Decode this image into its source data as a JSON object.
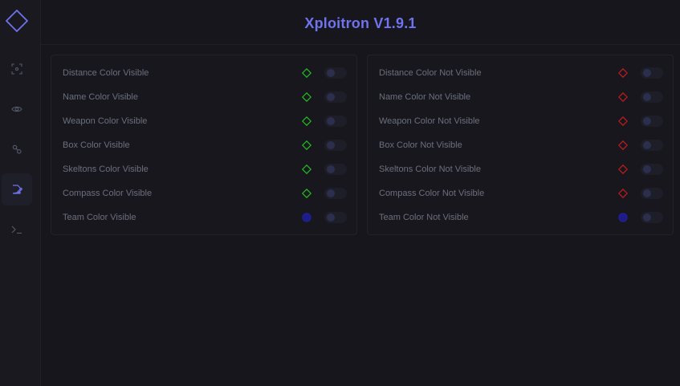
{
  "app": {
    "title": "Xploitron V1.9.1",
    "accent": "#6f73ee"
  },
  "sidebar": {
    "items": [
      {
        "icon": "aim-icon",
        "active": false
      },
      {
        "icon": "eye-icon",
        "active": false
      },
      {
        "icon": "settings-icon",
        "active": false
      },
      {
        "icon": "palette-icon",
        "active": true
      },
      {
        "icon": "terminal-icon",
        "active": false
      }
    ]
  },
  "visible": {
    "rows": [
      {
        "label": "Distance Color Visible",
        "color": "#22c222",
        "shape": "diamond",
        "enabled": false
      },
      {
        "label": "Name Color Visible",
        "color": "#22c222",
        "shape": "diamond",
        "enabled": false
      },
      {
        "label": "Weapon Color Visible",
        "color": "#22c222",
        "shape": "diamond",
        "enabled": false
      },
      {
        "label": "Box Color Visible",
        "color": "#22c222",
        "shape": "diamond",
        "enabled": false
      },
      {
        "label": "Skeltons Color Visible",
        "color": "#22c222",
        "shape": "diamond",
        "enabled": false
      },
      {
        "label": "Compass Color Visible",
        "color": "#22c222",
        "shape": "diamond",
        "enabled": false
      },
      {
        "label": "Team Color Visible",
        "color": "#1c1c8a",
        "shape": "circle",
        "enabled": false
      }
    ]
  },
  "not_visible": {
    "rows": [
      {
        "label": "Distance Color Not Visible",
        "color": "#c41c1c",
        "shape": "diamond",
        "enabled": false
      },
      {
        "label": "Name Color Not Visible",
        "color": "#c41c1c",
        "shape": "diamond",
        "enabled": false
      },
      {
        "label": "Weapon Color Not Visible",
        "color": "#c41c1c",
        "shape": "diamond",
        "enabled": false
      },
      {
        "label": "Box Color Not Visible",
        "color": "#c41c1c",
        "shape": "diamond",
        "enabled": false
      },
      {
        "label": "Skeltons Color Not Visible",
        "color": "#c41c1c",
        "shape": "diamond",
        "enabled": false
      },
      {
        "label": "Compass Color Not Visible",
        "color": "#c41c1c",
        "shape": "diamond",
        "enabled": false
      },
      {
        "label": "Team Color Not Visible",
        "color": "#1c1c8a",
        "shape": "circle",
        "enabled": false
      }
    ]
  }
}
